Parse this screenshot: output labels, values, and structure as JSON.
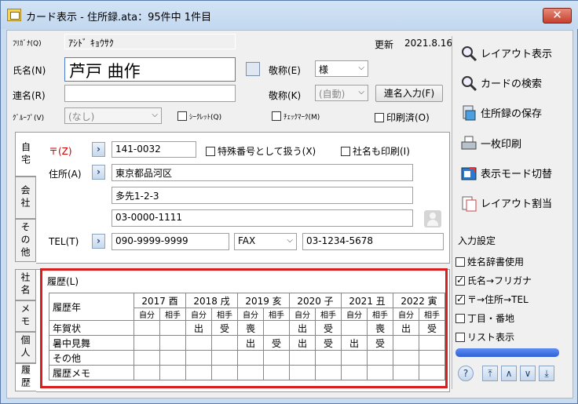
{
  "window": {
    "title": "カード表示 - 住所録.ata：95件中 1件目",
    "close_label": "✕"
  },
  "form": {
    "furigana_label": "ﾌﾘｶﾞﾅ(Q)",
    "furigana_value": "ｱｼﾄﾞ ｷｮｳｻｸ",
    "updated_label": "更新",
    "updated_value": "2021.8.16",
    "name_label": "氏名(N)",
    "name_value": "芦戸 曲作",
    "honorific_label": "敬称(E)",
    "honorific_value": "様",
    "joint_label": "連名(R)",
    "joint_value": "",
    "honorific2_label": "敬称(K)",
    "honorific2_value": "(自動)",
    "joint_input_button": "連名入力(F)",
    "group_label": "ｸﾞﾙｰﾌﾟ(V)",
    "group_value": "(なし)",
    "secret_label": "ｼｰｸﾚｯﾄ(Q)",
    "checkmark_label": "ﾁｪｯｸﾏｰｸ(M)",
    "printed_label": "印刷済(O)"
  },
  "tabs": {
    "home": "自宅",
    "company": "会社",
    "other": "その他",
    "company2": "社名",
    "memo": "メモ",
    "personal": "個人",
    "history": "履歴"
  },
  "address": {
    "zip_label": "〒(Z)",
    "zip_value": "141-0032",
    "special_zip_label": "特殊番号として扱う(X)",
    "print_company_label": "社名も印刷(I)",
    "address_label": "住所(A)",
    "line1": "東京都品河区",
    "line2": "多先1-2-3",
    "line3": "03-0000-1111",
    "tel_label": "TEL(T)",
    "tel_value": "090-9999-9999",
    "fax_select": "FAX",
    "fax_value": "03-1234-5678"
  },
  "history": {
    "label": "履歴(L)",
    "header": "履歴年",
    "years": [
      "2017 酉",
      "2018 戌",
      "2019 亥",
      "2020 子",
      "2021 丑",
      "2022 寅"
    ],
    "sub_self": "自分",
    "sub_other": "相手",
    "rows": [
      {
        "label": "年賀状",
        "cells": [
          "",
          "",
          "出",
          "受",
          "喪",
          "",
          "出",
          "受",
          "",
          "喪",
          "出",
          "受"
        ]
      },
      {
        "label": "暑中見舞",
        "cells": [
          "",
          "",
          "",
          "",
          "出",
          "受",
          "出",
          "受",
          "出",
          "受",
          "",
          ""
        ]
      },
      {
        "label": "その他",
        "cells": [
          "",
          "",
          "",
          "",
          "",
          "",
          "",
          "",
          "",
          "",
          "",
          ""
        ]
      },
      {
        "label": "履歴メモ",
        "cells": [
          "",
          "",
          "",
          "",
          "",
          "",
          "",
          "",
          "",
          "",
          "",
          ""
        ]
      }
    ]
  },
  "side": {
    "layout_view": "レイアウト表示",
    "card_search": "カードの検索",
    "save": "住所録の保存",
    "print_one": "一枚印刷",
    "mode_switch": "表示モード切替",
    "layout_assign": "レイアウト割当",
    "input_settings": "入力設定",
    "opt_dict": "姓名辞書使用",
    "opt_furigana": "氏名→フリガナ",
    "opt_zip": "〒→住所→TEL",
    "opt_chome": "丁目・番地",
    "opt_list": "リスト表示"
  }
}
